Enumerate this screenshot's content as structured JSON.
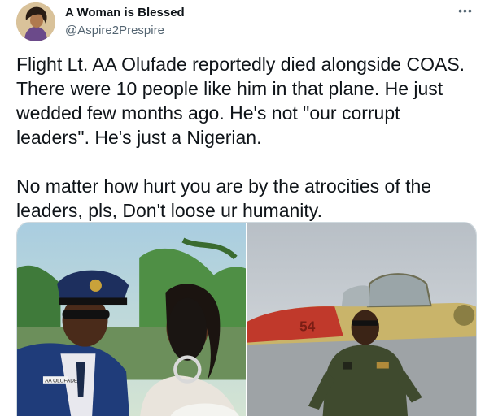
{
  "author": {
    "name": "A Woman is Blessed",
    "handle": "@Aspire2Prespire"
  },
  "tweet": {
    "text": "Flight Lt. AA Olufade reportedly died alongside COAS.\nThere were 10 people like him in that plane. He just\nwedded few months ago. He's not \"our corrupt\nleaders\". He's just a Nigerian.\n\nNo matter how hurt you are by the atrocities of the\nleaders, pls, Don't loose ur humanity."
  },
  "media": {
    "photo1": {
      "nametag": "AA OLUFADE"
    },
    "photo2": {
      "aircraft_number": "54"
    }
  },
  "icons": {
    "more": "more-icon"
  }
}
